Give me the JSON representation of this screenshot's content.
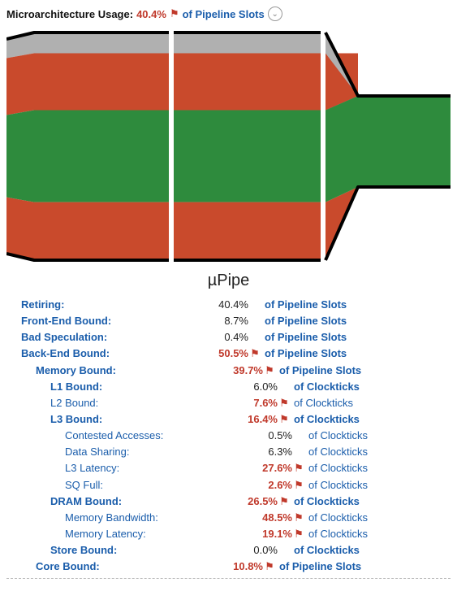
{
  "header": {
    "label": "Microarchitecture Usage:",
    "value": "40.4%",
    "flagged": true,
    "unit_text": "of Pipeline Slots"
  },
  "pipe_title": "µPipe",
  "flag_glyph": "⚑",
  "chevron_glyph": "⌄",
  "chart_data": {
    "type": "pipe-diagram",
    "description": "Top-down microarchitecture pipeline usage diagram. Horizontal bands represent share of pipeline slots. Colors: green=Retiring, orange=Back-End/Memory bound, gray=Front-End/Bad Speculation. Width narrowing to the right indicates effective throughput loss.",
    "bands": [
      {
        "name": "Front-End / Bad Spec",
        "color": "#b0b0b0",
        "share_pct": 9.1
      },
      {
        "name": "Back-End Bound (upper)",
        "color": "#c94a2c",
        "share_pct": 25.0
      },
      {
        "name": "Retiring",
        "color": "#2e8b3d",
        "share_pct": 40.4
      },
      {
        "name": "Back-End Bound (lower)",
        "color": "#c94a2c",
        "share_pct": 25.5
      }
    ],
    "stages": 3,
    "outlet_fraction": 0.4
  },
  "metrics": [
    {
      "name": "Retiring",
      "value": "40.4%",
      "flagged": false,
      "unit": "of Pipeline Slots",
      "indent": 1,
      "bold": true
    },
    {
      "name": "Front-End Bound",
      "value": "8.7%",
      "flagged": false,
      "unit": "of Pipeline Slots",
      "indent": 1,
      "bold": true
    },
    {
      "name": "Bad Speculation",
      "value": "0.4%",
      "flagged": false,
      "unit": "of Pipeline Slots",
      "indent": 1,
      "bold": true
    },
    {
      "name": "Back-End Bound",
      "value": "50.5%",
      "flagged": true,
      "unit": "of Pipeline Slots",
      "indent": 1,
      "bold": true
    },
    {
      "name": "Memory Bound",
      "value": "39.7%",
      "flagged": true,
      "unit": "of Pipeline Slots",
      "indent": 2,
      "bold": true
    },
    {
      "name": "L1 Bound",
      "value": "6.0%",
      "flagged": false,
      "unit": "of Clockticks",
      "indent": 3,
      "bold": true
    },
    {
      "name": "L2 Bound",
      "value": "7.6%",
      "flagged": true,
      "unit": "of Clockticks",
      "indent": 3,
      "bold": false
    },
    {
      "name": "L3 Bound",
      "value": "16.4%",
      "flagged": true,
      "unit": "of Clockticks",
      "indent": 3,
      "bold": true
    },
    {
      "name": "Contested Accesses",
      "value": "0.5%",
      "flagged": false,
      "unit": "of Clockticks",
      "indent": 4,
      "bold": false
    },
    {
      "name": "Data Sharing",
      "value": "6.3%",
      "flagged": false,
      "unit": "of Clockticks",
      "indent": 4,
      "bold": false
    },
    {
      "name": "L3 Latency",
      "value": "27.6%",
      "flagged": true,
      "unit": "of Clockticks",
      "indent": 4,
      "bold": false
    },
    {
      "name": "SQ Full",
      "value": "2.6%",
      "flagged": true,
      "unit": "of Clockticks",
      "indent": 4,
      "bold": false
    },
    {
      "name": "DRAM Bound",
      "value": "26.5%",
      "flagged": true,
      "unit": "of Clockticks",
      "indent": 3,
      "bold": true
    },
    {
      "name": "Memory Bandwidth",
      "value": "48.5%",
      "flagged": true,
      "unit": "of Clockticks",
      "indent": 4,
      "bold": false
    },
    {
      "name": "Memory Latency",
      "value": "19.1%",
      "flagged": true,
      "unit": "of Clockticks",
      "indent": 4,
      "bold": false
    },
    {
      "name": "Store Bound",
      "value": "0.0%",
      "flagged": false,
      "unit": "of Clockticks",
      "indent": 3,
      "bold": true
    },
    {
      "name": "Core Bound",
      "value": "10.8%",
      "flagged": true,
      "unit": "of Pipeline Slots",
      "indent": 2,
      "bold": true
    }
  ]
}
